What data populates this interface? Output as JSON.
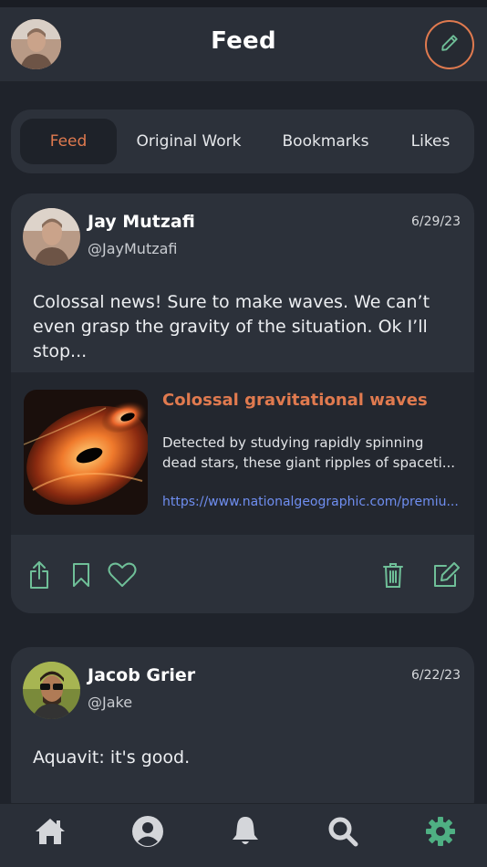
{
  "header": {
    "title": "Feed",
    "compose_icon": "pencil-icon",
    "avatar_icon": "user-avatar"
  },
  "tabs": [
    {
      "label": "Feed",
      "active": true
    },
    {
      "label": "Original Work",
      "active": false
    },
    {
      "label": "Bookmarks",
      "active": false
    },
    {
      "label": "Likes",
      "active": false
    }
  ],
  "posts": [
    {
      "author_name": "Jay Mutzafi",
      "author_handle": "@JayMutzafi",
      "date": "6/29/23",
      "text": "Colossal news! Sure to make waves. We can’t even grasp the gravity of the situation. Ok I’ll stop...",
      "link": {
        "title": "Colossal gravitational waves",
        "description_line1": "Detected by studying rapidly spinning",
        "description_line2": "dead stars, these giant ripples of spaceti...",
        "url": "https://www.nationalgeographic.com/premiu..."
      },
      "actions": {
        "share_icon": "share-icon",
        "bookmark_icon": "bookmark-icon",
        "like_icon": "heart-icon",
        "delete_icon": "trash-icon",
        "edit_icon": "edit-icon"
      }
    },
    {
      "author_name": "Jacob Grier",
      "author_handle": "@Jake",
      "date": "6/22/23",
      "text": "Aquavit: it's good."
    }
  ],
  "bottom_nav": {
    "items": [
      "home-icon",
      "profile-icon",
      "bell-icon",
      "search-icon",
      "gear-icon"
    ],
    "active": "gear-icon"
  },
  "colors": {
    "accent": "#e07a4f",
    "icon_green": "#6fbf98",
    "active_nav": "#4fb083",
    "nav_icon": "#d4d6da",
    "link": "#6f8ef0",
    "card_bg": "#2c313a",
    "page_bg": "#1f232b"
  }
}
